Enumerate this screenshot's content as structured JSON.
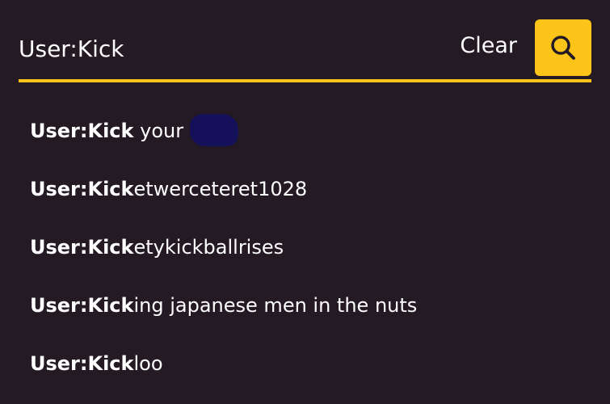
{
  "search": {
    "value": "User:Kick",
    "clear_label": "Clear",
    "search_icon": "search-icon"
  },
  "colors": {
    "background": "#241a24",
    "accent": "#fcc418",
    "text": "#ffffff",
    "redaction": "#14105a"
  },
  "suggestions": [
    {
      "match": "User:Kick",
      "rest": " your",
      "redacted": true
    },
    {
      "match": "User:Kick",
      "rest": "etwerceteret1028"
    },
    {
      "match": "User:Kick",
      "rest": "etykickballrises"
    },
    {
      "match": "User:Kick",
      "rest": "ing japanese men in the nuts"
    },
    {
      "match": "User:Kick",
      "rest": "loo"
    }
  ]
}
